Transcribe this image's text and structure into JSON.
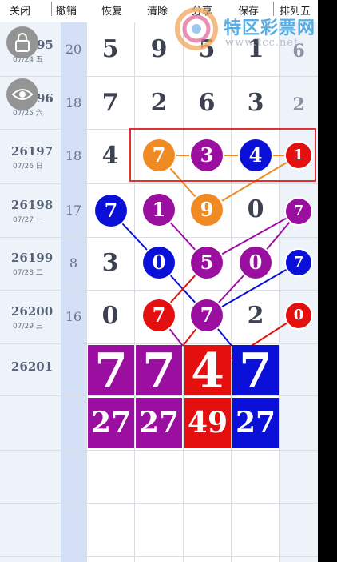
{
  "toolbar": {
    "buttons": [
      {
        "label": "关闭",
        "icon": "close-icon"
      },
      {
        "label": "撤销",
        "icon": "undo-icon"
      },
      {
        "label": "恢复",
        "icon": "redo-icon"
      },
      {
        "label": "清除",
        "icon": "clear-icon"
      },
      {
        "label": "分享",
        "icon": "share-icon"
      },
      {
        "label": "保存",
        "icon": "save-icon"
      },
      {
        "label": "排列五",
        "icon": "menu-icon"
      }
    ]
  },
  "watermark": {
    "title": "特区彩票网",
    "url": "www.tcc.net"
  },
  "floating": {
    "lock_icon": "lock-icon",
    "eye_icon": "eye-icon"
  },
  "rows": [
    {
      "issue": "26195",
      "issue_visible": "95",
      "date": "07/24 五",
      "sum": "20",
      "digits": [
        "5",
        "9",
        "5",
        "1"
      ],
      "last": "6"
    },
    {
      "issue": "26196",
      "issue_visible": "96",
      "date": "07/25 六",
      "sum": "18",
      "digits": [
        "7",
        "2",
        "6",
        "3"
      ],
      "last": "2"
    },
    {
      "issue": "26197",
      "date": "07/26 日",
      "sum": "18",
      "digits": [
        "4",
        "7",
        "3",
        "4"
      ],
      "last": "1"
    },
    {
      "issue": "26198",
      "date": "07/27 一",
      "sum": "17",
      "digits": [
        "7",
        "1",
        "9",
        "0"
      ],
      "last": "7"
    },
    {
      "issue": "26199",
      "date": "07/28 二",
      "sum": "8",
      "digits": [
        "3",
        "0",
        "5",
        "0"
      ],
      "last": "7"
    },
    {
      "issue": "26200",
      "date": "07/29 三",
      "sum": "16",
      "digits": [
        "0",
        "7",
        "7",
        "2"
      ],
      "last": "0"
    }
  ],
  "next_issue": "26201",
  "prediction": {
    "digits": [
      "7",
      "7",
      "4",
      "7"
    ],
    "counts": [
      "27",
      "27",
      "49",
      "27"
    ]
  },
  "colors": {
    "orange": "#f08a22",
    "purple": "#9b0fa0",
    "blue": "#0a10d8",
    "red": "#e41010",
    "highlight": "#e03030"
  }
}
